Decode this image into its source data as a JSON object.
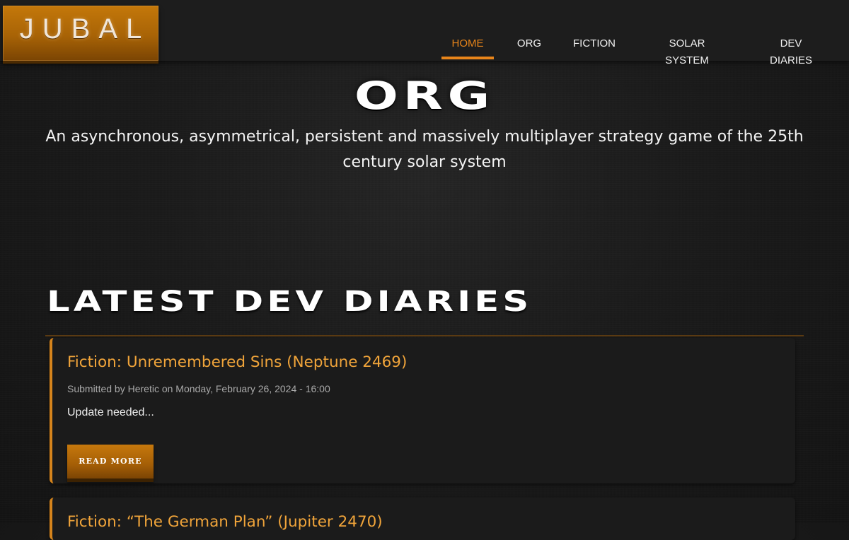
{
  "header": {
    "logo_text": "JUBAL",
    "nav": [
      {
        "label": "HOME",
        "active": true
      },
      {
        "label": "ORG",
        "active": false
      },
      {
        "label": "FICTION",
        "active": false
      },
      {
        "label": "SOLAR SYSTEM",
        "active": false
      },
      {
        "label": "DEV DIARIES",
        "active": false
      }
    ]
  },
  "hero": {
    "title": "ORG",
    "subtitle": "An asynchronous, asymmetrical, persistent and massively multiplayer strategy game of the 25th century solar system"
  },
  "section": {
    "title": "LATEST DEV DIARIES"
  },
  "posts": [
    {
      "title": "Fiction: Unremembered Sins (Neptune 2469)",
      "meta": "Submitted by Heretic on Monday, February 26, 2024 - 16:00",
      "excerpt": "Update needed...",
      "read_more": "READ MORE"
    },
    {
      "title": "Fiction: “The German Plan” (Jupiter 2470)"
    }
  ],
  "colors": {
    "accent": "#e8851a",
    "card_title": "#f0a43a",
    "logo_bg": "#b86a08",
    "background": "#1a1a1a"
  }
}
